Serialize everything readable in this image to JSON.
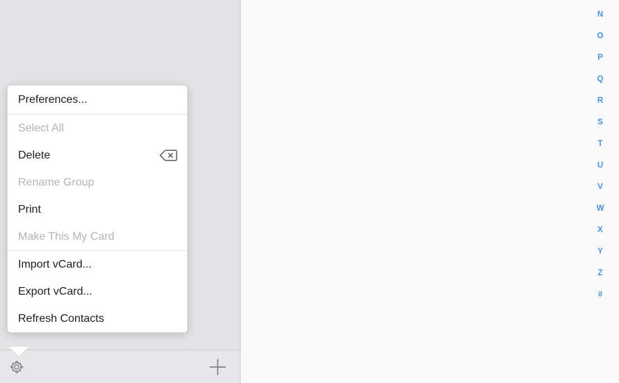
{
  "window": {
    "title": "Contacts",
    "sidebar_bg": "#e4e4e6",
    "content_bg": "#fafafa",
    "accent": "#4a90e2"
  },
  "sidebar": {
    "toolbar": {
      "gear_icon": "gear-icon",
      "gear_label": "Settings",
      "add_icon": "plus-icon",
      "add_label": "Add"
    }
  },
  "popup_menu": {
    "groups": [
      {
        "items": [
          {
            "label": "Preferences...",
            "enabled": true,
            "shortcut": ""
          }
        ]
      },
      {
        "items": [
          {
            "label": "Select All",
            "enabled": false,
            "shortcut": ""
          },
          {
            "label": "Delete",
            "enabled": true,
            "shortcut": "delete-key-icon"
          },
          {
            "label": "Rename Group",
            "enabled": false,
            "shortcut": ""
          },
          {
            "label": "Print",
            "enabled": true,
            "shortcut": ""
          },
          {
            "label": "Make This My Card",
            "enabled": false,
            "shortcut": ""
          }
        ]
      },
      {
        "items": [
          {
            "label": "Import vCard...",
            "enabled": true,
            "shortcut": ""
          },
          {
            "label": "Export vCard...",
            "enabled": true,
            "shortcut": ""
          },
          {
            "label": "Refresh Contacts",
            "enabled": true,
            "shortcut": ""
          }
        ]
      }
    ]
  },
  "alpha_index": {
    "color": "#4a90e2",
    "letters": [
      "N",
      "O",
      "P",
      "Q",
      "R",
      "S",
      "T",
      "U",
      "V",
      "W",
      "X",
      "Y",
      "Z",
      "#"
    ]
  }
}
